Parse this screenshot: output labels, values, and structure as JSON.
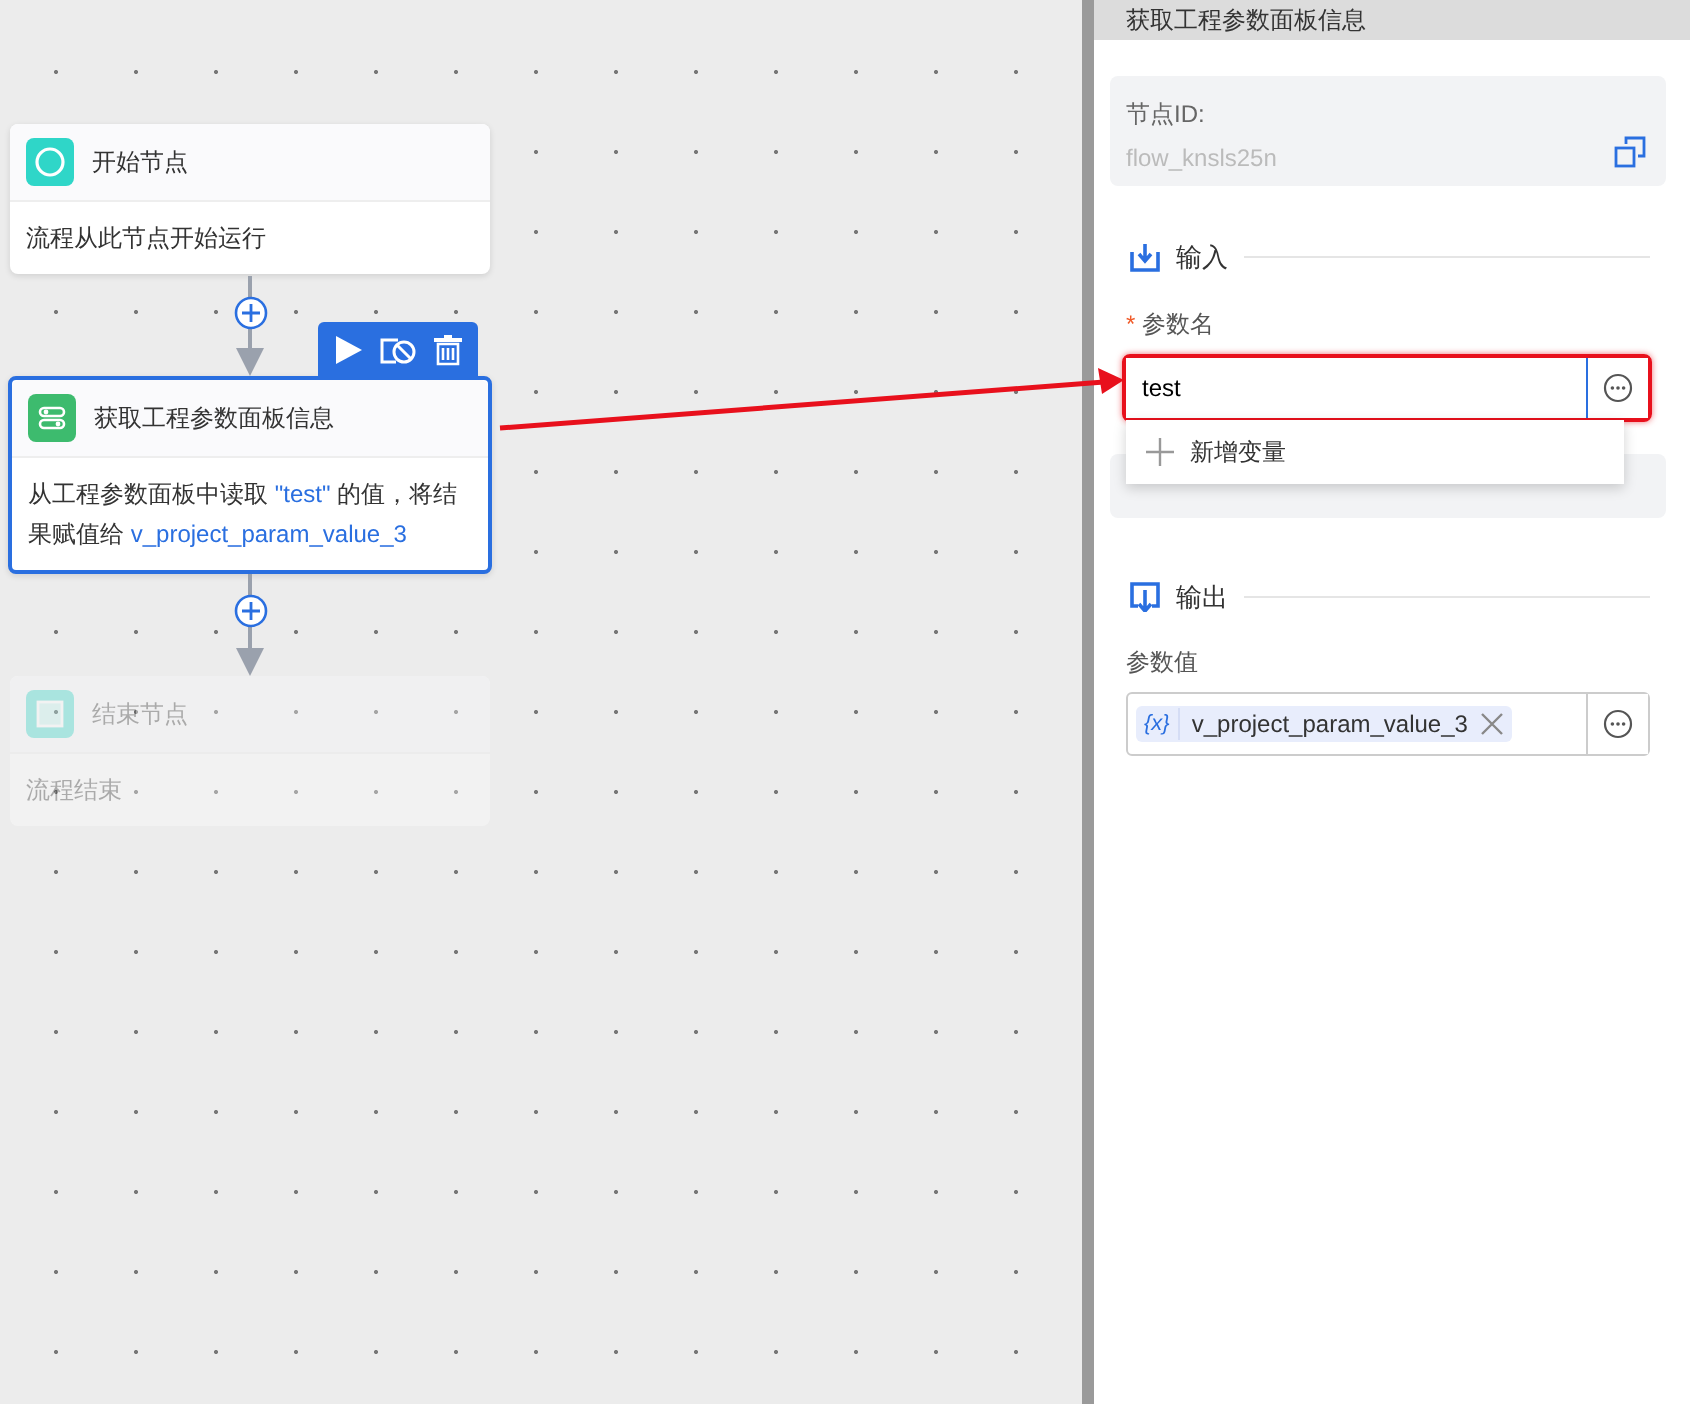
{
  "canvas": {
    "nodes": [
      {
        "kind": "start",
        "title": "开始节点",
        "selected": false,
        "disabled": false,
        "description": [
          {
            "kind": "plain",
            "text": "流程从此节点开始运行"
          }
        ]
      },
      {
        "kind": "action",
        "title": "获取工程参数面板信息",
        "selected": true,
        "disabled": false,
        "description": [
          {
            "kind": "plain",
            "text": "从工程参数面板中读取 "
          },
          {
            "kind": "ref",
            "text": "\"test\""
          },
          {
            "kind": "plain",
            "text": " 的值，将结果赋值给 "
          },
          {
            "kind": "ref",
            "text": "v_project_param_value_3"
          }
        ]
      },
      {
        "kind": "end",
        "title": "结束节点",
        "selected": false,
        "disabled": true,
        "description": [
          {
            "kind": "plain",
            "text": "流程结束"
          }
        ]
      }
    ]
  },
  "panel": {
    "title": "获取工程参数面板信息",
    "node_id": {
      "label": "节点ID:",
      "value": "flow_knsls25n"
    },
    "sections": [
      {
        "kind": "input",
        "heading": "输入",
        "field": {
          "label": "参数名",
          "required_mark": "*",
          "value": "test",
          "highlighted": true,
          "dropdown": [
            "新增变量"
          ]
        }
      },
      {
        "kind": "output",
        "heading": "输出",
        "field": {
          "label": "参数值",
          "tag_icon": "{x}",
          "tag": "v_project_param_value_3"
        }
      }
    ]
  }
}
